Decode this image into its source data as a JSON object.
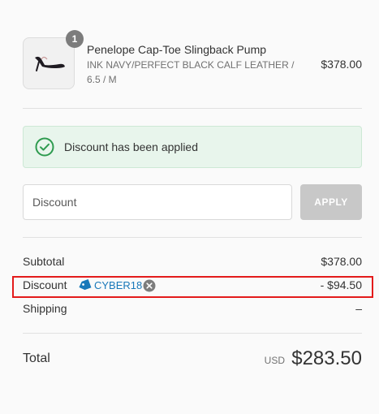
{
  "product": {
    "quantity": "1",
    "name": "Penelope Cap-Toe Slingback Pump",
    "variant": "INK NAVY/PERFECT BLACK CALF LEATHER / 6.5 / M",
    "price": "$378.00",
    "image_icon": "shoe-icon"
  },
  "banner": {
    "icon": "check-circle-icon",
    "message": "Discount has been applied"
  },
  "discount_form": {
    "placeholder": "Discount",
    "value": "",
    "apply_label": "APPLY"
  },
  "totals": {
    "subtotal_label": "Subtotal",
    "subtotal_value": "$378.00",
    "discount_label": "Discount",
    "discount_code": "CYBER18",
    "discount_value": "- $94.50",
    "shipping_label": "Shipping",
    "shipping_value": "–",
    "total_label": "Total",
    "currency": "USD",
    "total_value": "$283.50"
  },
  "colors": {
    "success_bg": "#e8f5ec",
    "success_icon": "#2e9b4f",
    "code_link": "#1878b9",
    "highlight_border": "#e31b1b",
    "button_disabled": "#c8c8c8"
  }
}
